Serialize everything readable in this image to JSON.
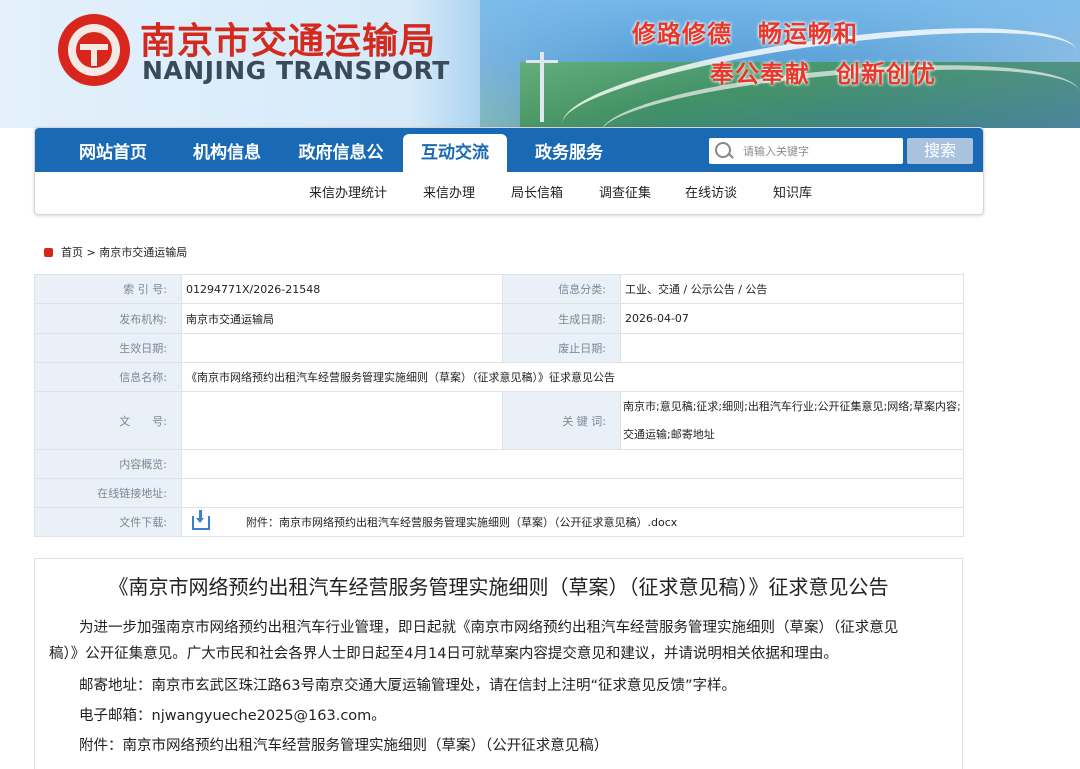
{
  "header": {
    "logo_cn": "南京市交通运输局",
    "logo_en": "NANJING TRANSPORT",
    "slogans": [
      "修路修德",
      "畅运畅和",
      "奉公奉献",
      "创新创优"
    ]
  },
  "nav": {
    "items": [
      {
        "label": "网站首页"
      },
      {
        "label": "机构信息"
      },
      {
        "label": "政府信息公"
      },
      {
        "label": "互动交流",
        "active": true
      },
      {
        "label": "政务服务"
      }
    ],
    "search_placeholder": "请输入关键字",
    "search_button": "搜索",
    "subitems": [
      "来信办理统计",
      "来信办理",
      "局长信箱",
      "调查征集",
      "在线访谈",
      "知识库"
    ]
  },
  "breadcrumb": {
    "home": "首页",
    "sep": ">",
    "current": "南京市交通运输局"
  },
  "meta": {
    "index_label": "索 引 号:",
    "index_value": "01294771X/2026-21548",
    "category_label": "信息分类:",
    "category_value": "工业、交通 / 公示公告 / 公告",
    "publisher_label": "发布机构:",
    "publisher_value": "南京市交通运输局",
    "created_label": "生成日期:",
    "created_value": "2026-04-07",
    "effective_label": "生效日期:",
    "effective_value": "",
    "repeal_label": "废止日期:",
    "repeal_value": "",
    "name_label": "信息名称:",
    "name_value": "《南京市网络预约出租汽车经营服务管理实施细则（草案）（征求意见稿）》征求意见公告",
    "doc_label": "文　　号:",
    "doc_value": "",
    "keywords_label": "关 键 词:",
    "keywords_line1": "南京市;意见稿;征求;细则;出租汽车行业;公开征集意见;网络;草案内容;",
    "keywords_line2": "交通运输;邮寄地址",
    "summary_label": "内容概览:",
    "summary_value": "",
    "link_label": "在线链接地址:",
    "link_value": "",
    "download_label": "文件下载:",
    "download_value": "附件：南京市网络预约出租汽车经营服务管理实施细则（草案）（公开征求意见稿）.docx"
  },
  "article": {
    "title": "《南京市网络预约出租汽车经营服务管理实施细则（草案）（征求意见稿）》征求意见公告",
    "para1_line1": "为进一步加强南京市网络预约出租汽车行业管理，即日起就《南京市网络预约出租汽车经营服务管理实施细则（草案）（征求意见",
    "para1_line2": "稿）》公开征集意见。广大市民和社会各界人士即日起至4月14日可就草案内容提交意见和建议，并请说明相关依据和理由。",
    "mail": "邮寄地址：南京市玄武区珠江路63号南京交通大厦运输管理处，请在信封上注明“征求意见反馈”字样。",
    "email": "电子邮箱：njwangyueche2025@163.com。",
    "attachment": "附件：南京市网络预约出租汽车经营服务管理实施细则（草案）（公开征求意见稿）"
  }
}
